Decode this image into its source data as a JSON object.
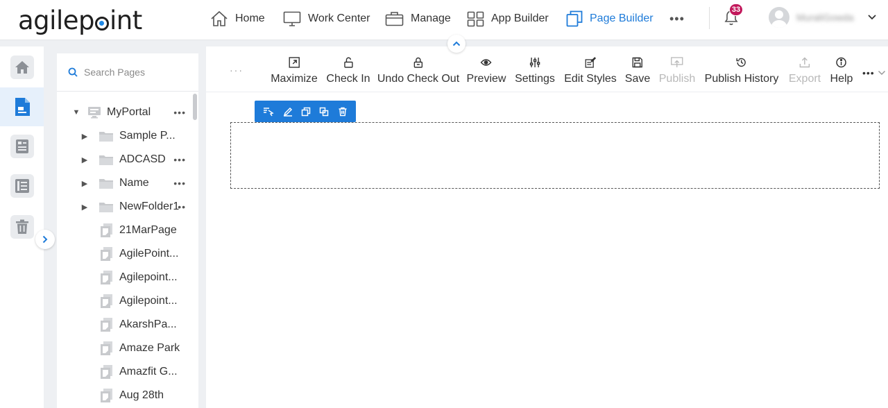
{
  "brand": {
    "logo_prefix": "agilep",
    "logo_suffix": "int"
  },
  "nav": {
    "items": [
      {
        "label": "Home",
        "icon": "home-icon"
      },
      {
        "label": "Work Center",
        "icon": "monitor-icon"
      },
      {
        "label": "Manage",
        "icon": "briefcase-icon"
      },
      {
        "label": "App Builder",
        "icon": "grid-icon"
      },
      {
        "label": "Page Builder",
        "icon": "copy-pages-icon",
        "active": true
      }
    ],
    "more_label": "•••"
  },
  "notifications": {
    "count": "33"
  },
  "user": {
    "name": "MuraliGowda"
  },
  "search": {
    "placeholder": "Search Pages"
  },
  "tree": {
    "root": {
      "label": "MyPortal",
      "more": "•••"
    },
    "items": [
      {
        "label": "Sample P...",
        "type": "folder",
        "more": ""
      },
      {
        "label": "ADCASD",
        "type": "folder",
        "more": "•••"
      },
      {
        "label": "Name",
        "type": "folder",
        "more": "•••"
      },
      {
        "label": "NewFolder1",
        "type": "folder",
        "more": "••"
      },
      {
        "label": "21MarPage",
        "type": "page",
        "more": ""
      },
      {
        "label": "AgilePoint...",
        "type": "page",
        "more": ""
      },
      {
        "label": "Agilepoint...",
        "type": "page",
        "more": ""
      },
      {
        "label": "Agilepoint...",
        "type": "page",
        "more": ""
      },
      {
        "label": "AkarshPa...",
        "type": "page",
        "more": ""
      },
      {
        "label": "Amaze Park",
        "type": "page",
        "more": ""
      },
      {
        "label": "Amazfit G...",
        "type": "page",
        "more": ""
      },
      {
        "label": "Aug 28th",
        "type": "page",
        "more": ""
      }
    ]
  },
  "toolbar": {
    "left_more": "···",
    "buttons": [
      {
        "label": "Maximize",
        "icon": "maximize-icon",
        "enabled": true
      },
      {
        "label": "Check In",
        "icon": "unlock-icon",
        "enabled": true
      },
      {
        "label": "Undo Check Out",
        "icon": "lock-undo-icon",
        "enabled": true
      },
      {
        "label": "Preview",
        "icon": "eye-icon",
        "enabled": true
      },
      {
        "label": "Settings",
        "icon": "sliders-icon",
        "enabled": true
      },
      {
        "label": "Edit Styles",
        "icon": "edit-styles-icon",
        "enabled": true
      },
      {
        "label": "Save",
        "icon": "save-icon",
        "enabled": true
      },
      {
        "label": "Publish",
        "icon": "publish-icon",
        "enabled": false
      },
      {
        "label": "Publish History",
        "icon": "history-icon",
        "enabled": true
      },
      {
        "label": "Export",
        "icon": "export-icon",
        "enabled": false
      },
      {
        "label": "Help",
        "icon": "info-icon",
        "enabled": true
      }
    ],
    "overflow": "•••"
  },
  "colors": {
    "accent": "#1e7bd9",
    "badge": "#c2185b",
    "disabled": "#b8b8b8"
  }
}
